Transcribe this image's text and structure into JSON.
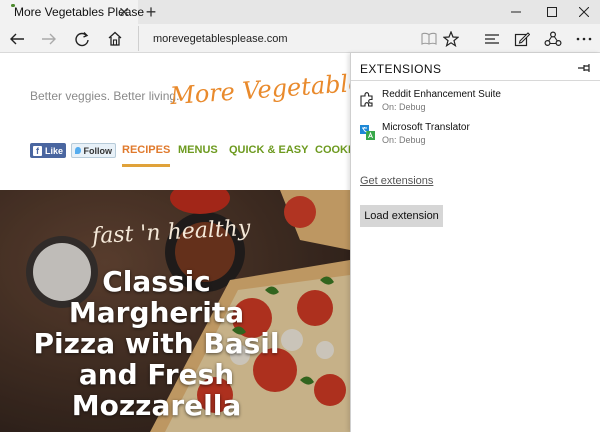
{
  "tab": {
    "title": "More Vegetables Please",
    "close_glyph": "✕",
    "favicon": "tomato-icon"
  },
  "new_tab": {
    "glyph": "+"
  },
  "window_controls": {
    "minimize": "minimize-icon",
    "maximize": "maximize-icon",
    "close": "close-icon"
  },
  "toolbar": {
    "back": "back-arrow-icon",
    "forward": "forward-arrow-icon",
    "refresh": "refresh-icon",
    "home": "home-icon",
    "url": "morevegetablesplease.com",
    "reading_view": "reading-view-icon",
    "favorite": "star-icon",
    "hub": "hub-icon",
    "web_note": "web-note-icon",
    "share": "share-icon",
    "more": "more-icon"
  },
  "page": {
    "tagline": "Better veggies. Better living.",
    "logo_text": "More Vegetables",
    "social": {
      "like": "Like",
      "follow": "Follow"
    },
    "nav": [
      "RECIPES",
      "MENUS",
      "QUICK & EASY",
      "COOKI"
    ],
    "hero": {
      "subtitle": "fast 'n healthy",
      "title_lines": [
        "Classic",
        "Margherita",
        "Pizza with Basil",
        "and Fresh",
        "Mozzarella"
      ]
    }
  },
  "extensions": {
    "header": "EXTENSIONS",
    "pin": "pin-icon",
    "items": [
      {
        "name": "Reddit Enhancement Suite",
        "status": "On: Debug",
        "icon": "puzzle-piece-icon"
      },
      {
        "name": "Microsoft Translator",
        "status": "On: Debug",
        "icon": "translator-icon"
      }
    ],
    "get_extensions": "Get extensions",
    "load_extension": "Load extension"
  },
  "colors": {
    "accent_orange": "#e98a2c",
    "nav_green": "#6d9a1f",
    "nav_active": "#e07a2d",
    "facebook_blue": "#4a66a0",
    "twitter_blue": "#55acee"
  }
}
